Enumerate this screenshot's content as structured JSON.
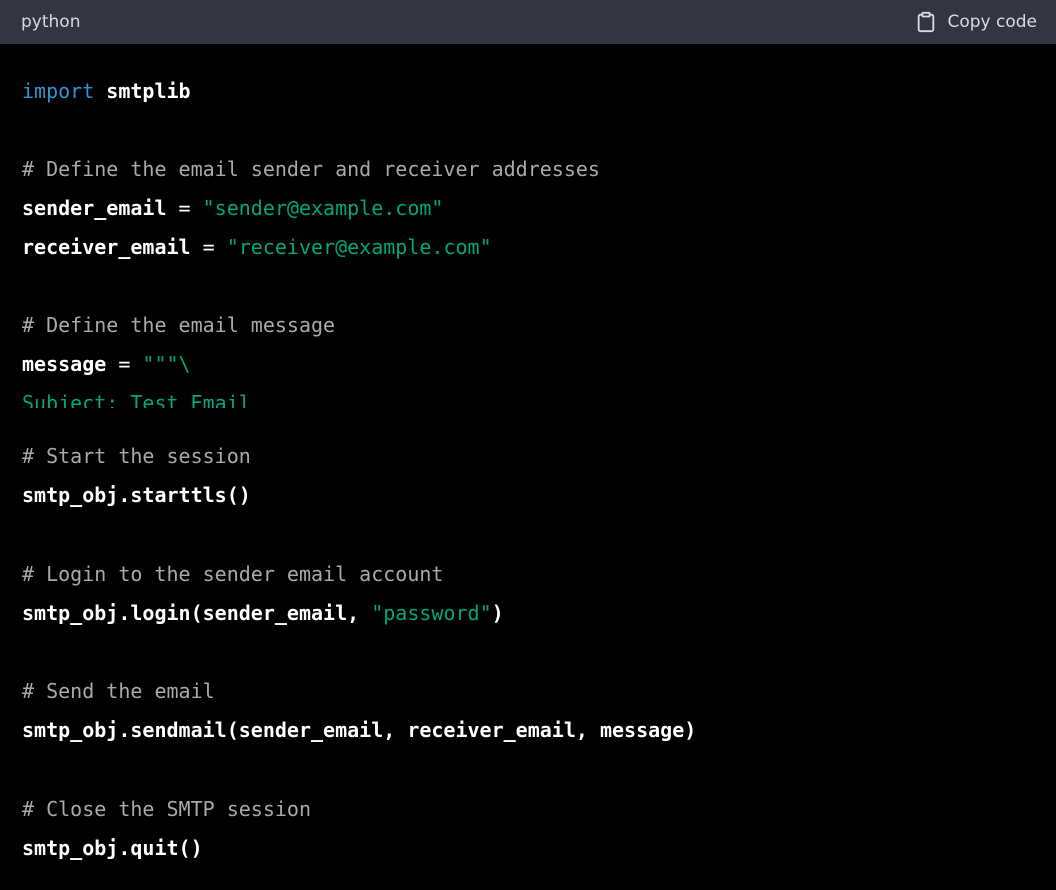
{
  "header": {
    "language": "python",
    "copy_label": "Copy code"
  },
  "icons": {
    "copy": "clipboard-icon"
  },
  "colors": {
    "header_bg": "#343541",
    "code_bg": "#000000",
    "keyword": "#2e95d3",
    "string": "#00a67d",
    "comment": "#a9a9a9",
    "text": "#ffffff"
  },
  "code_top": [
    [
      {
        "t": "kw",
        "v": "import"
      },
      {
        "t": "pl",
        "v": " "
      },
      {
        "t": "tx",
        "v": "smtplib"
      }
    ],
    [],
    [
      {
        "t": "cm",
        "v": "# Define the email sender and receiver addresses"
      }
    ],
    [
      {
        "t": "tx",
        "v": "sender_email"
      },
      {
        "t": "pl",
        "v": " = "
      },
      {
        "t": "str",
        "v": "\"sender@example.com\""
      }
    ],
    [
      {
        "t": "tx",
        "v": "receiver_email"
      },
      {
        "t": "pl",
        "v": " = "
      },
      {
        "t": "str",
        "v": "\"receiver@example.com\""
      }
    ],
    [],
    [
      {
        "t": "cm",
        "v": "# Define the email message"
      }
    ],
    [
      {
        "t": "tx",
        "v": "message"
      },
      {
        "t": "pl",
        "v": " = "
      },
      {
        "t": "str",
        "v": "\"\"\"\\"
      }
    ],
    [
      {
        "t": "str",
        "v": "Subject: Test Email"
      }
    ]
  ],
  "code_bottom": [
    [
      {
        "t": "cm",
        "v": "# Start the session"
      }
    ],
    [
      {
        "t": "tx",
        "v": "smtp_obj.starttls()"
      }
    ],
    [],
    [
      {
        "t": "cm",
        "v": "# Login to the sender email account"
      }
    ],
    [
      {
        "t": "tx",
        "v": "smtp_obj.login(sender_email, "
      },
      {
        "t": "str",
        "v": "\"password\""
      },
      {
        "t": "tx",
        "v": ")"
      }
    ],
    [],
    [
      {
        "t": "cm",
        "v": "# Send the email"
      }
    ],
    [
      {
        "t": "tx",
        "v": "smtp_obj.sendmail(sender_email, receiver_email, message)"
      }
    ],
    [],
    [
      {
        "t": "cm",
        "v": "# Close the SMTP session"
      }
    ],
    [
      {
        "t": "tx",
        "v": "smtp_obj.quit()"
      }
    ]
  ]
}
